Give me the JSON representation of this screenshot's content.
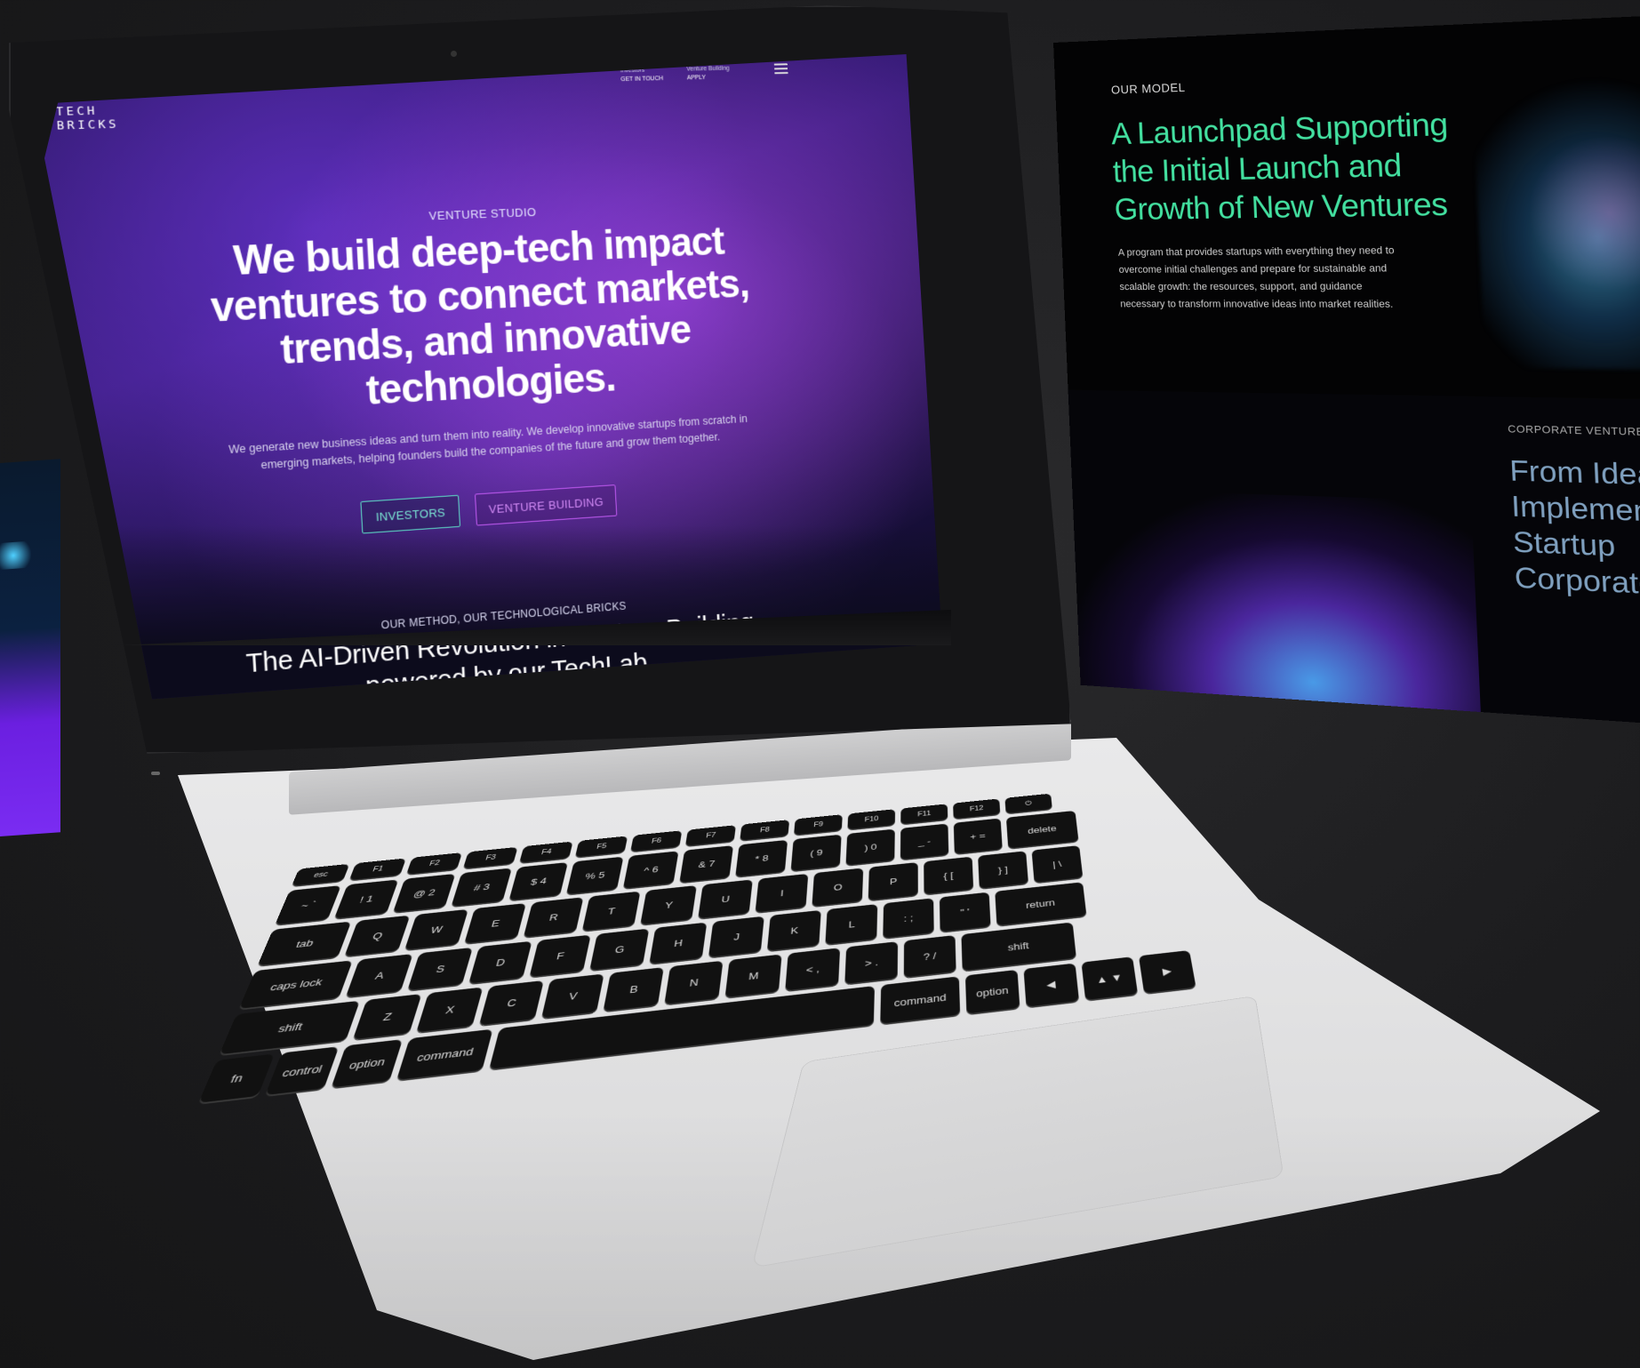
{
  "site": {
    "logo_line1": "TECH",
    "logo_line2": "BRICKS",
    "nav": [
      {
        "label": "Investors",
        "action": "GET IN TOUCH"
      },
      {
        "label": "Venture Building",
        "action": "APPLY"
      }
    ],
    "hero": {
      "eyebrow": "VENTURE STUDIO",
      "title": "We build deep-tech impact ventures to connect markets, trends, and innovative technologies.",
      "subtitle": "We generate new business ideas and turn them into reality. We develop innovative startups from scratch in emerging markets, helping founders build the companies of the future and grow them together.",
      "buttons": [
        "INVESTORS",
        "VENTURE BUILDING"
      ]
    },
    "method": {
      "eyebrow": "OUR METHOD, OUR TECHNOLOGICAL BRICKS",
      "title": "The AI-Driven Revolution in Venture Building powered by our TechLab"
    }
  },
  "slide": {
    "eyebrow": "OUR MODEL",
    "title": "A Launchpad Supporting the Initial Launch and Growth of New Ventures",
    "description": "A program that provides startups with everything they need to overcome initial challenges and prepare for sustainable and scalable growth: the resources, support, and guidance necessary to transform innovative ideas into market realities.",
    "eyebrow2": "CORPORATE VENTURE",
    "title2": "From Idea Implementation Startup Corporate"
  },
  "keyboard": {
    "row0": [
      "esc",
      "F1",
      "F2",
      "F3",
      "F4",
      "F5",
      "F6",
      "F7",
      "F8",
      "F9",
      "F10",
      "F11",
      "F12",
      "⏻"
    ],
    "row1": [
      "~ `",
      "! 1",
      "@ 2",
      "# 3",
      "$ 4",
      "% 5",
      "^ 6",
      "& 7",
      "* 8",
      "( 9",
      ") 0",
      "_ -",
      "+ =",
      "delete"
    ],
    "row2": [
      "tab",
      "Q",
      "W",
      "E",
      "R",
      "T",
      "Y",
      "U",
      "I",
      "O",
      "P",
      "{ [",
      "} ]",
      "| \\"
    ],
    "row3": [
      "caps lock",
      "A",
      "S",
      "D",
      "F",
      "G",
      "H",
      "J",
      "K",
      "L",
      ": ;",
      "\" '",
      "return"
    ],
    "row4": [
      "shift",
      "Z",
      "X",
      "C",
      "V",
      "B",
      "N",
      "M",
      "< ,",
      "> .",
      "? /",
      "shift"
    ],
    "row5": [
      "fn",
      "control",
      "option",
      "command",
      "",
      "command",
      "option",
      "◀",
      "▲ ▼",
      "▶"
    ]
  },
  "colors": {
    "accent_green": "#43e0a0",
    "accent_teal": "#5fe1c9",
    "accent_purple": "#c45cf5",
    "hero_bg": "#3b1d7e"
  }
}
